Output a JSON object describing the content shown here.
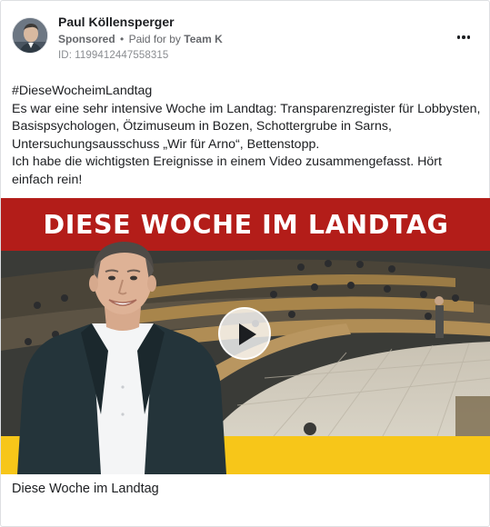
{
  "post": {
    "author": "Paul Köllensperger",
    "sponsored_label": "Sponsored",
    "separator": "•",
    "paid_for_prefix": "Paid for by",
    "payer": "Team K",
    "ad_id": "ID: 1199412447558315",
    "more_icon": "more-horizontal-icon",
    "avatar_icon": "profile-photo"
  },
  "text": {
    "hashtag": "#DieseWocheimLandtag",
    "lines": [
      "Es war eine sehr intensive Woche im Landtag: Transparenzregister für Lobbysten,",
      "Basispsychologen, Ötzimuseum in Bozen, Schottergrube in Sarns,",
      "Untersuchungsausschuss „Wir für Arno“, Bettenstopp.",
      "Ich habe die wichtigsten Ereignisse in einem Video zusammengefasst. Hört",
      "einfach rein!"
    ]
  },
  "media": {
    "banner_title": "DIESE WOCHE IM LANDTAG",
    "play_icon": "play-icon",
    "colors": {
      "banner": "#b31d19",
      "bottom_bar": "#f7c619"
    }
  },
  "link_caption": "Diese Woche im Landtag"
}
